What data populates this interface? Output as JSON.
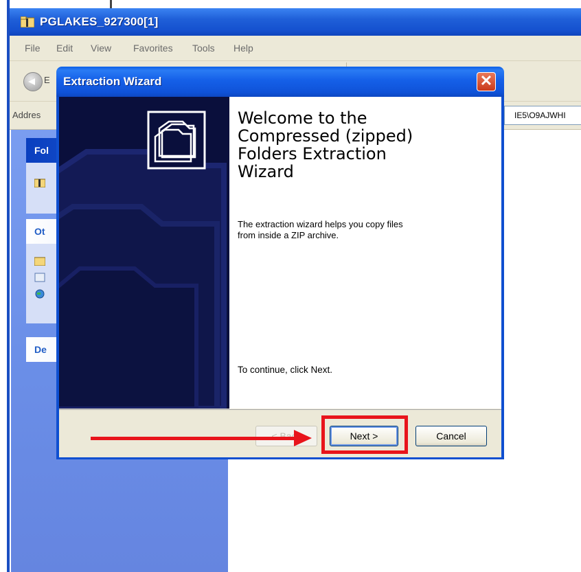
{
  "explorer": {
    "title": "PGLAKES_927300[1]",
    "menu": [
      "File",
      "Edit",
      "View",
      "Favorites",
      "Tools",
      "Help"
    ],
    "address_label": "Addres",
    "address_value": "IE5\\O9AJWHI",
    "back_label": "E",
    "taskpane": {
      "section1_title": "Fol",
      "section2_title": "Ot",
      "section3_title": "De"
    }
  },
  "wizard": {
    "title": "Extraction Wizard",
    "close_symbol": "✕",
    "heading": "Welcome to the\nCompressed (zipped)\nFolders Extraction\nWizard",
    "description": "The extraction wizard helps you copy files\nfrom inside a ZIP archive.",
    "continue_text": "To continue, click Next.",
    "buttons": {
      "back": "< Back",
      "next": "Next >",
      "cancel": "Cancel"
    }
  },
  "annotation": {
    "color": "#e8141b",
    "target": "next-button"
  }
}
